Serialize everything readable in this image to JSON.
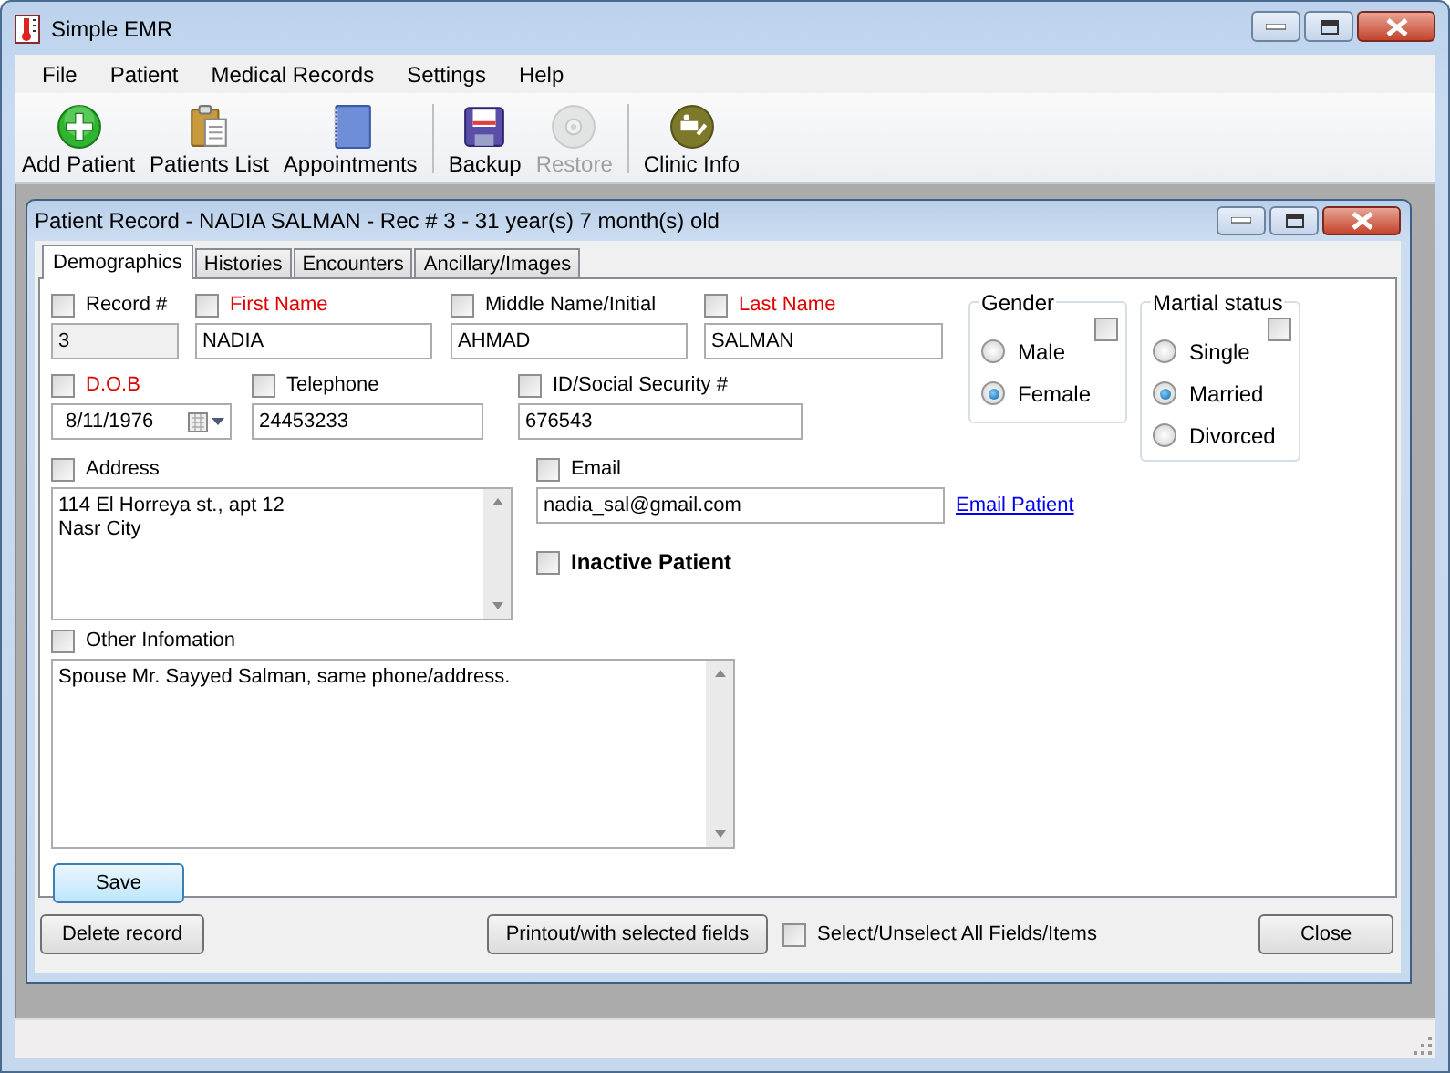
{
  "window": {
    "title": "Simple EMR"
  },
  "menu": [
    "File",
    "Patient",
    "Medical Records",
    "Settings",
    "Help"
  ],
  "toolbar": {
    "groups": [
      {
        "items": [
          {
            "label": "Add Patient",
            "kind": "add",
            "disabled": false
          },
          {
            "label": "Patients List",
            "kind": "list",
            "disabled": false
          },
          {
            "label": "Appointments",
            "kind": "notebook",
            "disabled": false
          }
        ]
      },
      {
        "items": [
          {
            "label": "Backup",
            "kind": "floppy",
            "disabled": false
          },
          {
            "label": "Restore",
            "kind": "disc",
            "disabled": true
          }
        ]
      },
      {
        "items": [
          {
            "label": "Clinic Info",
            "kind": "info",
            "disabled": false
          }
        ]
      }
    ]
  },
  "record_window": {
    "title": "Patient Record - NADIA SALMAN - Rec # 3 - 31 year(s) 7 month(s) old",
    "tabs": [
      {
        "label": "Demographics",
        "selected": true
      },
      {
        "label": "Histories",
        "selected": false
      },
      {
        "label": "Encounters",
        "selected": false
      },
      {
        "label": "Ancillary/Images",
        "selected": false
      }
    ],
    "record_number": {
      "label": "Record #",
      "checked": false,
      "required": false,
      "readonly": true,
      "value": "3"
    },
    "first_name": {
      "label": "First Name",
      "checked": false,
      "required": true,
      "readonly": false,
      "value": "NADIA"
    },
    "middle_name": {
      "label": "Middle Name/Initial",
      "checked": false,
      "required": false,
      "readonly": false,
      "value": "AHMAD"
    },
    "last_name": {
      "label": "Last Name",
      "checked": false,
      "required": true,
      "readonly": false,
      "value": "SALMAN"
    },
    "dob": {
      "label": "D.O.B",
      "checked": false,
      "required": true,
      "readonly": false,
      "value": "8/11/1976"
    },
    "telephone": {
      "label": "Telephone",
      "checked": false,
      "required": false,
      "readonly": false,
      "value": "24453233"
    },
    "id_number": {
      "label": "ID/Social Security #",
      "checked": false,
      "required": false,
      "readonly": false,
      "value": "676543"
    },
    "gender": {
      "label": "Gender",
      "checked": false,
      "options": [
        {
          "label": "Male",
          "selected": false
        },
        {
          "label": "Female",
          "selected": true
        }
      ]
    },
    "marital_status": {
      "label": "Martial status",
      "checked": false,
      "options": [
        {
          "label": "Single",
          "selected": false
        },
        {
          "label": "Married",
          "selected": true
        },
        {
          "label": "Divorced",
          "selected": false
        }
      ]
    },
    "address": {
      "label": "Address",
      "checked": false,
      "required": false,
      "readonly": false,
      "value": "114 El Horreya st., apt 12\nNasr City"
    },
    "email": {
      "label": "Email",
      "checked": false,
      "required": false,
      "readonly": false,
      "value": "nadia_sal@gmail.com"
    },
    "email_link": "Email Patient",
    "inactive": {
      "label": "Inactive Patient",
      "checked": false
    },
    "other_info": {
      "label": "Other Infomation",
      "checked": false,
      "required": false,
      "readonly": false,
      "value": "Spouse Mr. Sayyed Salman, same phone/address."
    },
    "save_button": "Save",
    "delete_button": "Delete record",
    "print_button": "Printout/with selected fields",
    "select_all": {
      "label": "Select/Unselect All Fields/Items",
      "checked": false
    },
    "close_button": "Close"
  }
}
